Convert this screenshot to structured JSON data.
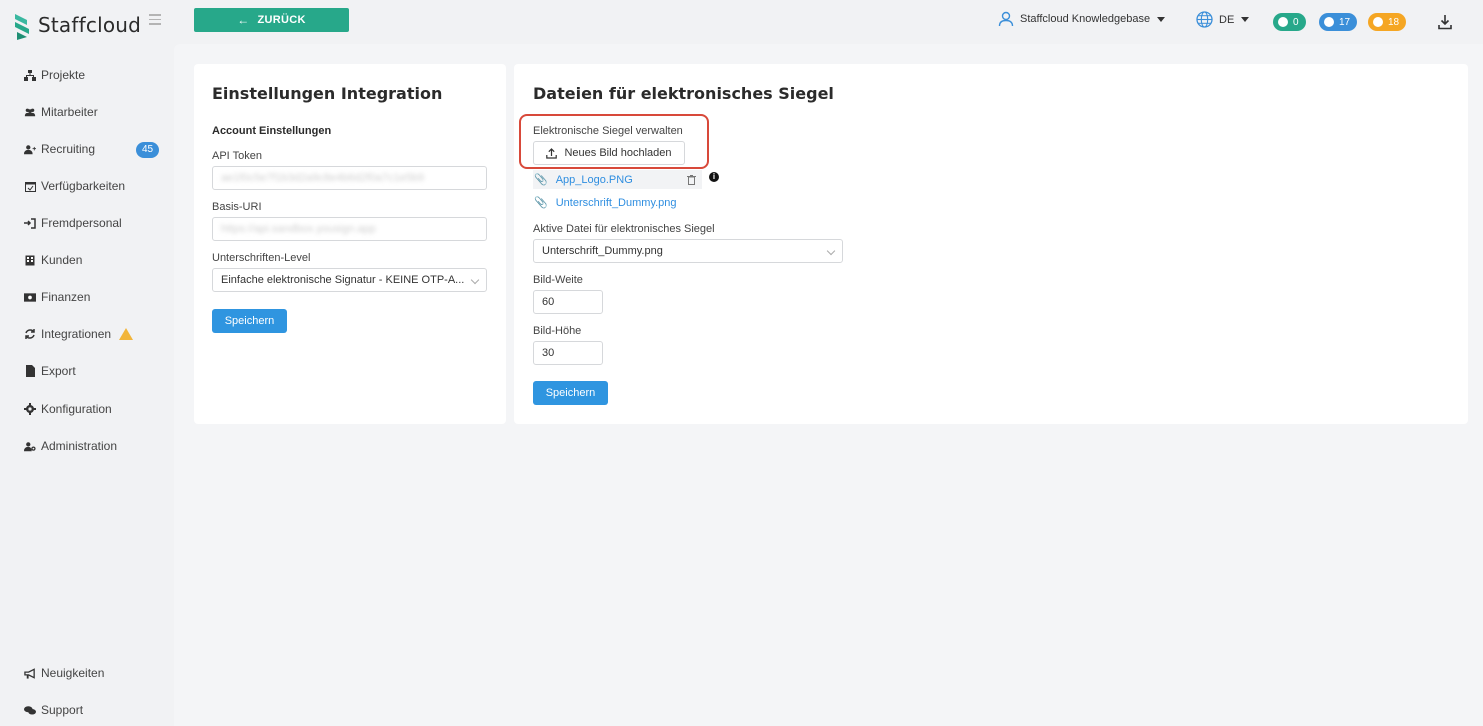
{
  "app": {
    "brand": "Staffcloud",
    "accent_color": "#27a88a"
  },
  "sidebar": {
    "items": [
      {
        "label": "Projekte",
        "icon": "sitemap-icon"
      },
      {
        "label": "Mitarbeiter",
        "icon": "users-icon"
      },
      {
        "label": "Recruiting",
        "icon": "user-plus-icon",
        "badge": "45"
      },
      {
        "label": "Verfügbarkeiten",
        "icon": "calendar-check-icon"
      },
      {
        "label": "Fremdpersonal",
        "icon": "sign-in-icon"
      },
      {
        "label": "Kunden",
        "icon": "building-icon"
      },
      {
        "label": "Finanzen",
        "icon": "money-bill-icon"
      },
      {
        "label": "Integrationen",
        "icon": "sync-icon",
        "warning": true
      },
      {
        "label": "Export",
        "icon": "file-icon"
      },
      {
        "label": "Konfiguration",
        "icon": "gear-icon"
      },
      {
        "label": "Administration",
        "icon": "user-cog-icon"
      }
    ],
    "footer": [
      {
        "label": "Neuigkeiten",
        "icon": "bullhorn-icon"
      },
      {
        "label": "Support",
        "icon": "comments-icon"
      }
    ]
  },
  "topbar": {
    "back_label": "ZURÜCK",
    "user_label": "Staffcloud Knowledgebase",
    "lang_label": "DE",
    "counts": {
      "messages": "0",
      "notifications": "17",
      "timers": "18"
    },
    "pill_colors": {
      "messages": "#27a88a",
      "notifications": "#3b8fd9",
      "timers": "#f5a623"
    }
  },
  "left_card": {
    "title": "Einstellungen Integration",
    "section": "Account Einstellungen",
    "api_token_label": "API Token",
    "api_token_value": "ae1f0c5e7f1b3d2a9c8e4b6d2f0a7c1e5b9",
    "base_uri_label": "Basis-URI",
    "base_uri_value": "https://api.sandbox.yousign.app",
    "level_label": "Unterschriften-Level",
    "level_value": "Einfache elektronische Signatur - KEINE OTP-A...",
    "save_label": "Speichern"
  },
  "right_card": {
    "title": "Dateien für elektronisches Siegel",
    "manage_label": "Elektronische Siegel verwalten",
    "upload_label": "Neues Bild hochladen",
    "files": [
      "App_Logo.PNG",
      "Unterschrift_Dummy.png"
    ],
    "active_label": "Aktive Datei für elektronisches Siegel",
    "active_value": "Unterschrift_Dummy.png",
    "width_label": "Bild-Weite",
    "width_value": "60",
    "height_label": "Bild-Höhe",
    "height_value": "30",
    "save_label": "Speichern"
  }
}
